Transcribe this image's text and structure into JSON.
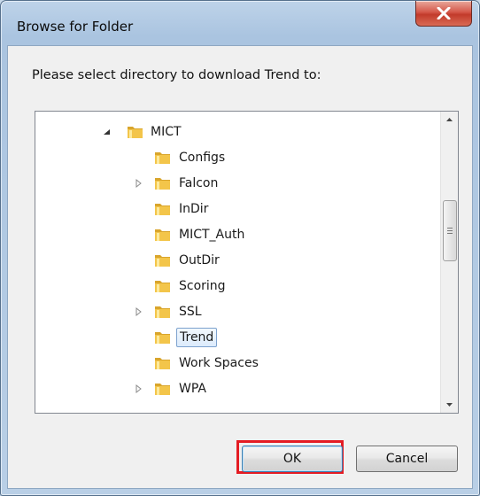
{
  "window": {
    "title": "Browse for Folder",
    "close_glyph": "X"
  },
  "dialog": {
    "prompt": "Please select directory to download Trend to:"
  },
  "tree": {
    "items": [
      {
        "label": "MICT",
        "expander": "expanded"
      },
      {
        "label": "Configs",
        "expander": "none"
      },
      {
        "label": "Falcon",
        "expander": "collapsed"
      },
      {
        "label": "InDir",
        "expander": "none"
      },
      {
        "label": "MICT_Auth",
        "expander": "none"
      },
      {
        "label": "OutDir",
        "expander": "none"
      },
      {
        "label": "Scoring",
        "expander": "none"
      },
      {
        "label": "SSL",
        "expander": "collapsed"
      },
      {
        "label": "Trend",
        "expander": "none",
        "selected": true
      },
      {
        "label": "Work Spaces",
        "expander": "none"
      },
      {
        "label": "WPA",
        "expander": "collapsed"
      }
    ]
  },
  "buttons": {
    "ok": "OK",
    "cancel": "Cancel"
  },
  "colors": {
    "highlight_border": "#e41c23",
    "selection_border": "#7da2ce",
    "folder": "#f3c54a"
  }
}
